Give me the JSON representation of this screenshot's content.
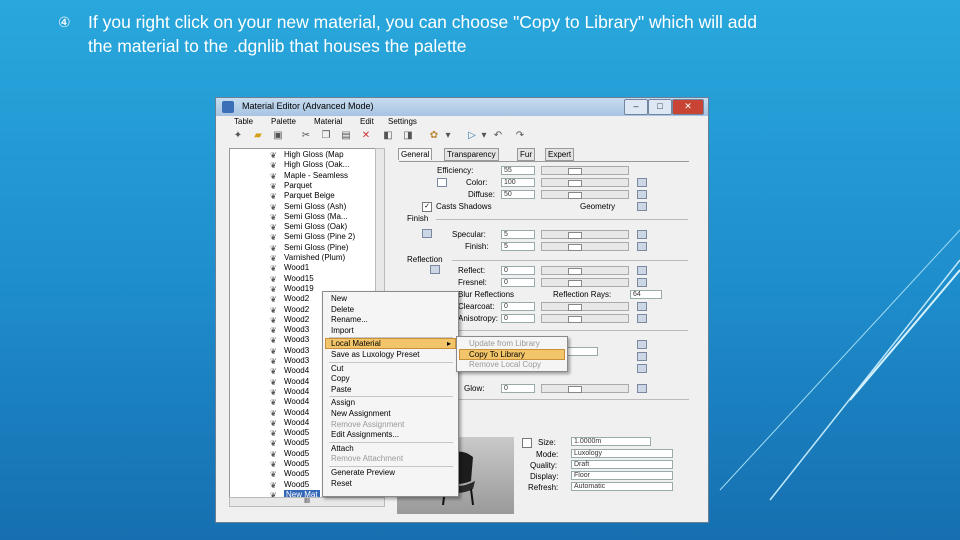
{
  "slide": {
    "bullet_symbol": "④",
    "bullet_text": "If you right click on your new material, you can choose \"Copy to Library\" which will add\nthe material to the .dgnlib that houses the palette"
  },
  "window": {
    "title": "Material Editor (Advanced Mode)",
    "controls": {
      "minimize": "–",
      "maximize": "□",
      "close": "✕"
    },
    "menus": [
      "Table",
      "Palette",
      "Material",
      "Edit",
      "Settings"
    ]
  },
  "tree": {
    "items": [
      "High Gloss (Map",
      "High Gloss (Oak...",
      "Maple - Seamless",
      "Parquet",
      "Parquet Beige",
      "Semi Gloss (Ash)",
      "Semi Gloss (Ma...",
      "Semi Gloss (Oak)",
      "Semi Gloss (Pine 2)",
      "Semi Gloss (Pine)",
      "Varnished (Plum)",
      "Wood1",
      "Wood15",
      "Wood19",
      "Wood2",
      "Wood2",
      "Wood2",
      "Wood3",
      "Wood3",
      "Wood3",
      "Wood3",
      "Wood4",
      "Wood4",
      "Wood4",
      "Wood4",
      "Wood4",
      "Wood4",
      "Wood5",
      "Wood5",
      "Wood5",
      "Wood5",
      "Wood5",
      "Wood5",
      "New Mat"
    ],
    "scroll_glyph": "III"
  },
  "tabs": [
    "General",
    "Transparency",
    "Fur",
    "Expert"
  ],
  "properties": {
    "efficiency": {
      "label": "Efficiency:",
      "value": "55"
    },
    "color": {
      "label": "Color:",
      "value": "100"
    },
    "diffuse": {
      "label": "Diffuse:",
      "value": "50"
    },
    "casts_shadows": "Casts Shadows",
    "geometry": "Geometry",
    "finish_section": "Finish",
    "specular": {
      "label": "Specular:",
      "value": "5"
    },
    "finish": {
      "label": "Finish:",
      "value": "5"
    },
    "reflection_section": "Reflection",
    "reflect": {
      "label": "Reflect:",
      "value": "0"
    },
    "fresnel": {
      "label": "Fresnel:",
      "value": "0"
    },
    "blur_reflections": "Blur Reflections",
    "reflection_rays": {
      "label": "Reflection Rays:",
      "value": "64"
    },
    "clearcoat": {
      "label": "Clearcoat:",
      "value": "0"
    },
    "anisotropy": {
      "label": "Anisotropy:",
      "value": "0"
    },
    "glow": {
      "label": "Glow:",
      "value": "0"
    },
    "size": {
      "label": "Size:",
      "value": "1.0000m"
    },
    "mode": {
      "label": "Mode:",
      "value": "Luxology"
    },
    "quality": {
      "label": "Quality:",
      "value": "Draft"
    },
    "display": {
      "label": "Display:",
      "value": "Floor"
    },
    "refresh": {
      "label": "Refresh:",
      "value": "Automatic"
    }
  },
  "context_menu": {
    "items": [
      {
        "label": "New",
        "disabled": false
      },
      {
        "label": "Delete",
        "disabled": false
      },
      {
        "label": "Rename...",
        "disabled": false
      },
      {
        "label": "Import",
        "disabled": false
      },
      {
        "label": "Local Material",
        "disabled": false,
        "highlighted": true,
        "arrow": "▸"
      },
      {
        "label": "Save as Luxology Preset",
        "disabled": false
      },
      {
        "label": "Cut",
        "disabled": false
      },
      {
        "label": "Copy",
        "disabled": false
      },
      {
        "label": "Paste",
        "disabled": false
      },
      {
        "label": "Assign",
        "disabled": false
      },
      {
        "label": "New Assignment",
        "disabled": false
      },
      {
        "label": "Remove Assignment",
        "disabled": true
      },
      {
        "label": "Edit Assignments...",
        "disabled": false
      },
      {
        "label": "Attach",
        "disabled": false
      },
      {
        "label": "Remove Attachment",
        "disabled": true
      },
      {
        "label": "Generate Preview",
        "disabled": false
      },
      {
        "label": "Reset",
        "disabled": false
      }
    ]
  },
  "submenu": {
    "items": [
      {
        "label": "Update from Library",
        "disabled": true
      },
      {
        "label": "Copy To Library",
        "disabled": false,
        "highlighted": true
      },
      {
        "label": "Remove Local Copy",
        "disabled": true
      }
    ]
  },
  "colors": {
    "highlight": "#f2c56a",
    "selection": "#3367b7",
    "background_top": "#29a8dd",
    "background_bottom": "#166fb0"
  }
}
